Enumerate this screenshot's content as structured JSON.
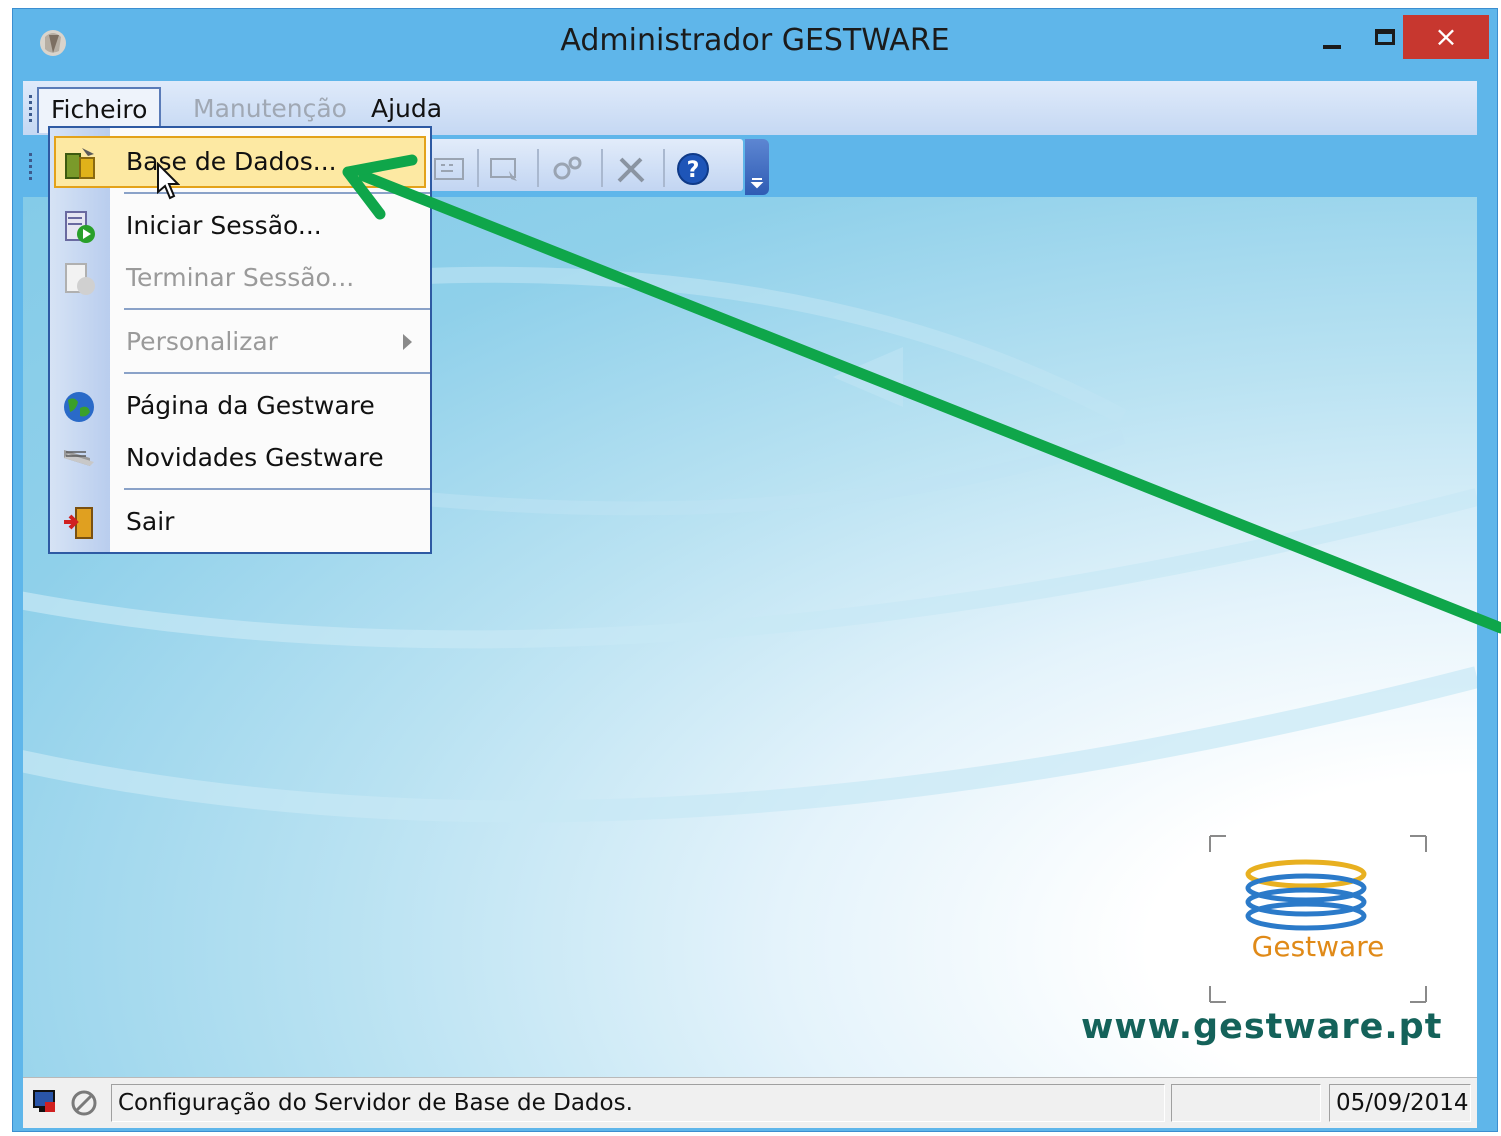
{
  "window": {
    "title": "Administrador GESTWARE",
    "close_glyph": "×",
    "icons": {
      "app": "app-icon",
      "minimize": "minimize-icon",
      "maximize": "maximize-icon",
      "close": "close-icon"
    }
  },
  "menubar": {
    "items": [
      {
        "label": "Ficheiro",
        "state": "open"
      },
      {
        "label": "Manutenção",
        "state": "disabled"
      },
      {
        "label": "Ajuda",
        "state": "normal"
      }
    ]
  },
  "file_menu": {
    "items": [
      {
        "label": "Base de Dados...",
        "icon": "database-tools-icon",
        "highlighted": true
      },
      {
        "label": "Iniciar Sessão...",
        "icon": "start-session-icon"
      },
      {
        "label": "Terminar Sessão...",
        "icon": "end-session-icon",
        "disabled": true
      },
      {
        "label": "Personalizar",
        "disabled": true,
        "submenu": true
      },
      {
        "label": "Página da Gestware",
        "icon": "globe-icon"
      },
      {
        "label": "Novidades Gestware",
        "icon": "news-icon"
      },
      {
        "label": "Sair",
        "icon": "exit-door-icon"
      }
    ]
  },
  "toolbar": {
    "icons": [
      "keyboard-icon",
      "window-cursor-icon",
      "gears-icon",
      "tools-icon",
      "help-icon",
      "toolbar-options-icon"
    ]
  },
  "content": {
    "logo_text": "Gestware",
    "website": "www.gestware.pt"
  },
  "statusbar": {
    "message": "Configuração do Servidor de Base de Dados.",
    "date": "05/09/2014",
    "icons": [
      "server-status-icon",
      "no-connection-icon"
    ]
  },
  "annotation": {
    "arrow_color": "#0fa64a"
  },
  "colors": {
    "titlebar": "#5fb6ea",
    "close_button": "#c7372f",
    "menu_highlight": "#fde9a3",
    "website_text": "#14625a",
    "logo_text": "#e08a18"
  }
}
